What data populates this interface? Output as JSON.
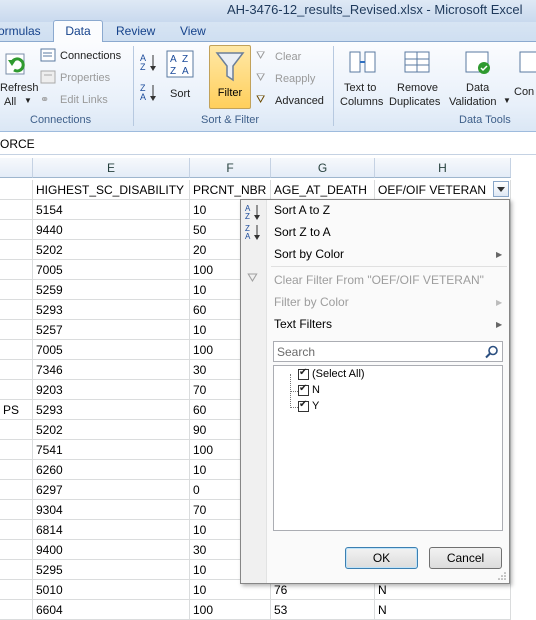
{
  "window": {
    "title": "AH-3476-12_results_Revised.xlsx  -  Microsoft Excel"
  },
  "tabs": [
    {
      "label": "ormulas"
    },
    {
      "label": "Data"
    },
    {
      "label": "Review"
    },
    {
      "label": "View"
    }
  ],
  "ribbon": {
    "connections_group": {
      "refresh_label": "Refresh",
      "refresh_all_label": "All",
      "connections_label": "Connections",
      "properties_label": "Properties",
      "edit_links_label": "Edit Links",
      "group_label": "Connections"
    },
    "sort_filter_group": {
      "sort_label": "Sort",
      "filter_label": "Filter",
      "clear_label": "Clear",
      "reapply_label": "Reapply",
      "advanced_label": "Advanced",
      "group_label": "Sort & Filter"
    },
    "data_tools_group": {
      "text_to_label": "Text to",
      "columns_label": "Columns",
      "remove_label": "Remove",
      "duplicates_label": "Duplicates",
      "data_label": "Data",
      "validation_label": "Validation",
      "con_label": "Con",
      "group_label": "Data Tools"
    }
  },
  "formula_bar": {
    "value": "ORCE"
  },
  "columns": [
    {
      "letter": "E",
      "header": "HIGHEST_SC_DISABILITY"
    },
    {
      "letter": "F",
      "header": "PRCNT_NBR"
    },
    {
      "letter": "G",
      "header": "AGE_AT_DEATH"
    },
    {
      "letter": "H",
      "header": "OEF/OIF VETERAN"
    }
  ],
  "rows": [
    {
      "d": "",
      "e": "5154",
      "f": "10",
      "g": "",
      "h": ""
    },
    {
      "d": "",
      "e": "9440",
      "f": "50",
      "g": "",
      "h": ""
    },
    {
      "d": "",
      "e": "5202",
      "f": "20",
      "g": "",
      "h": ""
    },
    {
      "d": "",
      "e": "7005",
      "f": "100",
      "g": "",
      "h": ""
    },
    {
      "d": "",
      "e": "5259",
      "f": "10",
      "g": "",
      "h": ""
    },
    {
      "d": "",
      "e": "5293",
      "f": "60",
      "g": "",
      "h": ""
    },
    {
      "d": "",
      "e": "5257",
      "f": "10",
      "g": "",
      "h": ""
    },
    {
      "d": "",
      "e": "7005",
      "f": "100",
      "g": "",
      "h": ""
    },
    {
      "d": "",
      "e": "7346",
      "f": "30",
      "g": "",
      "h": ""
    },
    {
      "d": "",
      "e": "9203",
      "f": "70",
      "g": "",
      "h": ""
    },
    {
      "d": "PS",
      "e": "5293",
      "f": "60",
      "g": "",
      "h": ""
    },
    {
      "d": "",
      "e": "5202",
      "f": "90",
      "g": "",
      "h": ""
    },
    {
      "d": "",
      "e": "7541",
      "f": "100",
      "g": "",
      "h": ""
    },
    {
      "d": "",
      "e": "6260",
      "f": "10",
      "g": "",
      "h": ""
    },
    {
      "d": "",
      "e": "6297",
      "f": "0",
      "g": "",
      "h": ""
    },
    {
      "d": "",
      "e": "9304",
      "f": "70",
      "g": "",
      "h": ""
    },
    {
      "d": "",
      "e": "6814",
      "f": "10",
      "g": "",
      "h": ""
    },
    {
      "d": "",
      "e": "9400",
      "f": "30",
      "g": "",
      "h": ""
    },
    {
      "d": "",
      "e": "5295",
      "f": "10",
      "g": "",
      "h": ""
    },
    {
      "d": "",
      "e": "5010",
      "f": "10",
      "g": "76",
      "h": "N"
    },
    {
      "d": "",
      "e": "6604",
      "f": "100",
      "g": "53",
      "h": "N"
    }
  ],
  "filter_menu": {
    "sort_az": "Sort A to Z",
    "sort_za": "Sort Z to A",
    "sort_by_color": "Sort by Color",
    "clear_filter": "Clear Filter From \"OEF/OIF VETERAN\"",
    "filter_by_color": "Filter by Color",
    "text_filters": "Text Filters",
    "search_placeholder": "Search",
    "list": [
      "(Select All)",
      "N",
      "Y"
    ],
    "ok_label": "OK",
    "cancel_label": "Cancel"
  },
  "colors": {
    "ribbon_bg": "#e8f0fa",
    "filter_active": "#ffcf5c",
    "tab_text": "#15428b"
  }
}
